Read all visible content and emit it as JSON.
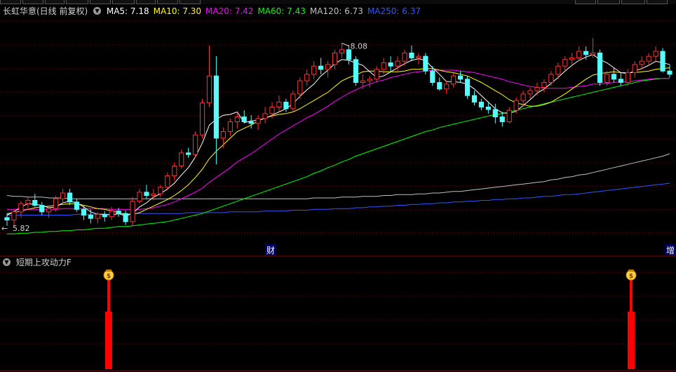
{
  "header": {
    "stock_title": "长虹华意(日线 前复权)",
    "ma_labels": [
      {
        "text": "MA5: 7.18",
        "color": "#ffffff"
      },
      {
        "text": "MA10: 7.30",
        "color": "#ffff00"
      },
      {
        "text": "MA20: 7.42",
        "color": "#ff00ff"
      },
      {
        "text": "MA60: 7.43",
        "color": "#00ff00"
      },
      {
        "text": "MA120: 6.73",
        "color": "#c0c0c0"
      },
      {
        "text": "MA250: 6.37",
        "color": "#3355ff"
      }
    ]
  },
  "sub_panel": {
    "title": "短期上攻动力F"
  },
  "markers": {
    "high_label": "8.08",
    "low_label": "5.82",
    "event_cai": "财",
    "event_zeng": "增",
    "money_glyph": "$"
  },
  "colors": {
    "up": "#ff3232",
    "down": "#54ffff",
    "ma5": "#ffffff",
    "ma10": "#ffff00",
    "ma20": "#ff00ff",
    "ma60": "#00ff00",
    "ma120": "#c0c0c0",
    "ma250": "#3355ff",
    "signal": "#ff0000",
    "grid": "#8b0000"
  },
  "chart_data": [
    {
      "type": "candlestick",
      "title": "长虹华意(日线 前复权)",
      "ylim": [
        5.65,
        8.35
      ],
      "candles": [
        [
          5.95,
          6.0,
          5.85,
          5.92
        ],
        [
          5.92,
          6.05,
          5.84,
          6.02
        ],
        [
          6.02,
          6.15,
          5.95,
          6.12
        ],
        [
          6.12,
          6.2,
          6.05,
          6.16
        ],
        [
          6.16,
          6.24,
          6.08,
          6.1
        ],
        [
          6.1,
          6.14,
          5.98,
          6.02
        ],
        [
          6.02,
          6.1,
          5.95,
          6.06
        ],
        [
          6.06,
          6.22,
          6.02,
          6.18
        ],
        [
          6.18,
          6.3,
          6.12,
          6.25
        ],
        [
          6.25,
          6.3,
          6.1,
          6.14
        ],
        [
          6.14,
          6.18,
          6.02,
          6.05
        ],
        [
          6.05,
          6.1,
          5.92,
          5.98
        ],
        [
          5.98,
          6.05,
          5.88,
          5.94
        ],
        [
          5.94,
          6.02,
          5.88,
          5.99
        ],
        [
          5.99,
          6.03,
          5.9,
          5.96
        ],
        [
          5.96,
          6.08,
          5.92,
          6.03
        ],
        [
          6.03,
          6.07,
          5.96,
          6.0
        ],
        [
          6.0,
          6.04,
          5.86,
          5.9
        ],
        [
          5.9,
          6.2,
          5.85,
          6.15
        ],
        [
          6.15,
          6.3,
          6.12,
          6.26
        ],
        [
          6.26,
          6.35,
          6.18,
          6.22
        ],
        [
          6.22,
          6.3,
          6.16,
          6.24
        ],
        [
          6.24,
          6.35,
          6.2,
          6.32
        ],
        [
          6.32,
          6.5,
          6.28,
          6.46
        ],
        [
          6.46,
          6.62,
          6.4,
          6.58
        ],
        [
          6.58,
          6.78,
          6.55,
          6.74
        ],
        [
          6.74,
          6.8,
          6.68,
          6.72
        ],
        [
          6.72,
          7.0,
          6.68,
          6.96
        ],
        [
          6.96,
          7.4,
          6.92,
          7.35
        ],
        [
          7.35,
          8.05,
          7.3,
          7.68
        ],
        [
          7.68,
          7.92,
          6.6,
          6.92
        ],
        [
          6.92,
          7.05,
          6.8,
          7.0
        ],
        [
          7.0,
          7.16,
          6.95,
          7.12
        ],
        [
          7.12,
          7.24,
          7.04,
          7.18
        ],
        [
          7.18,
          7.26,
          7.1,
          7.12
        ],
        [
          7.12,
          7.2,
          7.04,
          7.1
        ],
        [
          7.1,
          7.2,
          7.02,
          7.16
        ],
        [
          7.16,
          7.3,
          7.1,
          7.22
        ],
        [
          7.22,
          7.36,
          7.16,
          7.3
        ],
        [
          7.3,
          7.44,
          7.24,
          7.36
        ],
        [
          7.36,
          7.4,
          7.24,
          7.28
        ],
        [
          7.28,
          7.5,
          7.24,
          7.46
        ],
        [
          7.46,
          7.66,
          7.4,
          7.62
        ],
        [
          7.62,
          7.76,
          7.56,
          7.7
        ],
        [
          7.7,
          7.86,
          7.64,
          7.8
        ],
        [
          7.8,
          7.9,
          7.7,
          7.76
        ],
        [
          7.76,
          7.86,
          7.66,
          7.82
        ],
        [
          7.82,
          8.0,
          7.76,
          7.96
        ],
        [
          7.96,
          8.08,
          7.9,
          8.0
        ],
        [
          8.0,
          8.06,
          7.82,
          7.88
        ],
        [
          7.88,
          7.92,
          7.56,
          7.6
        ],
        [
          7.6,
          7.7,
          7.52,
          7.62
        ],
        [
          7.62,
          7.68,
          7.54,
          7.64
        ],
        [
          7.64,
          7.8,
          7.6,
          7.76
        ],
        [
          7.76,
          7.9,
          7.7,
          7.84
        ],
        [
          7.84,
          7.92,
          7.74,
          7.8
        ],
        [
          7.8,
          7.92,
          7.72,
          7.86
        ],
        [
          7.86,
          8.0,
          7.8,
          7.96
        ],
        [
          7.96,
          8.05,
          7.86,
          7.9
        ],
        [
          7.9,
          7.96,
          7.82,
          7.92
        ],
        [
          7.92,
          7.96,
          7.7,
          7.74
        ],
        [
          7.74,
          7.8,
          7.56,
          7.6
        ],
        [
          7.6,
          7.66,
          7.5,
          7.52
        ],
        [
          7.52,
          7.62,
          7.46,
          7.58
        ],
        [
          7.58,
          7.72,
          7.54,
          7.68
        ],
        [
          7.68,
          7.74,
          7.6,
          7.64
        ],
        [
          7.64,
          7.68,
          7.4,
          7.44
        ],
        [
          7.44,
          7.5,
          7.32,
          7.36
        ],
        [
          7.36,
          7.4,
          7.26,
          7.3
        ],
        [
          7.3,
          7.36,
          7.22,
          7.27
        ],
        [
          7.27,
          7.34,
          7.1,
          7.18
        ],
        [
          7.18,
          7.24,
          7.06,
          7.12
        ],
        [
          7.12,
          7.3,
          7.1,
          7.26
        ],
        [
          7.26,
          7.42,
          7.22,
          7.38
        ],
        [
          7.38,
          7.5,
          7.3,
          7.46
        ],
        [
          7.46,
          7.54,
          7.4,
          7.5
        ],
        [
          7.5,
          7.6,
          7.44,
          7.54
        ],
        [
          7.54,
          7.64,
          7.48,
          7.6
        ],
        [
          7.6,
          7.74,
          7.56,
          7.7
        ],
        [
          7.7,
          7.84,
          7.64,
          7.8
        ],
        [
          7.8,
          7.92,
          7.74,
          7.88
        ],
        [
          7.88,
          7.96,
          7.8,
          7.9
        ],
        [
          7.9,
          8.04,
          7.86,
          7.98
        ],
        [
          7.98,
          8.04,
          7.88,
          7.94
        ],
        [
          7.94,
          8.14,
          7.9,
          7.96
        ],
        [
          7.96,
          8.0,
          7.56,
          7.6
        ],
        [
          7.6,
          7.74,
          7.56,
          7.7
        ],
        [
          7.7,
          7.78,
          7.6,
          7.64
        ],
        [
          7.64,
          7.72,
          7.56,
          7.6
        ],
        [
          7.6,
          7.76,
          7.56,
          7.72
        ],
        [
          7.72,
          7.86,
          7.66,
          7.82
        ],
        [
          7.82,
          7.92,
          7.76,
          7.86
        ],
        [
          7.86,
          7.96,
          7.8,
          7.92
        ],
        [
          7.92,
          8.04,
          7.84,
          7.98
        ],
        [
          7.98,
          8.02,
          7.72,
          7.74
        ],
        [
          7.74,
          7.82,
          7.66,
          7.7
        ]
      ],
      "ma_lines": {
        "MA5": [
          5.98,
          6.02,
          6.08,
          6.12,
          6.11,
          6.1,
          6.07,
          6.08,
          6.13,
          6.15,
          6.13,
          6.08,
          6.02,
          5.99,
          5.99,
          5.98,
          6.0,
          5.97,
          6.0,
          6.08,
          6.13,
          6.2,
          6.24,
          6.3,
          6.37,
          6.47,
          6.56,
          6.69,
          6.86,
          7.08,
          7.15,
          7.2,
          7.21,
          7.24,
          7.11,
          7.13,
          7.14,
          7.16,
          7.2,
          7.24,
          7.28,
          7.34,
          7.43,
          7.51,
          7.58,
          7.68,
          7.75,
          7.83,
          7.88,
          7.87,
          7.84,
          7.81,
          7.73,
          7.66,
          7.68,
          7.73,
          7.78,
          7.83,
          7.87,
          7.89,
          7.87,
          7.78,
          7.7,
          7.61,
          7.61,
          7.6,
          7.58,
          7.52,
          7.44,
          7.36,
          7.28,
          7.23,
          7.22,
          7.25,
          7.32,
          7.39,
          7.47,
          7.52,
          7.59,
          7.66,
          7.74,
          7.81,
          7.87,
          7.91,
          7.94,
          7.88,
          7.84,
          7.78,
          7.72,
          7.71,
          7.74,
          7.77,
          7.81,
          7.86,
          7.84,
          7.82
        ],
        "MA10": [
          6.0,
          6.01,
          6.03,
          6.05,
          6.07,
          6.08,
          6.09,
          6.1,
          6.11,
          6.12,
          6.12,
          6.1,
          6.08,
          6.06,
          6.05,
          6.03,
          6.01,
          5.99,
          5.99,
          6.01,
          6.05,
          6.09,
          6.13,
          6.17,
          6.22,
          6.28,
          6.35,
          6.44,
          6.54,
          6.67,
          6.76,
          6.84,
          6.92,
          7.0,
          7.04,
          7.08,
          7.13,
          7.17,
          7.19,
          7.21,
          7.22,
          7.24,
          7.28,
          7.33,
          7.38,
          7.43,
          7.48,
          7.55,
          7.62,
          7.66,
          7.69,
          7.73,
          7.74,
          7.74,
          7.73,
          7.73,
          7.73,
          7.74,
          7.76,
          7.76,
          7.77,
          7.77,
          7.75,
          7.73,
          7.72,
          7.7,
          7.68,
          7.64,
          7.6,
          7.55,
          7.5,
          7.45,
          7.39,
          7.35,
          7.33,
          7.31,
          7.31,
          7.33,
          7.36,
          7.41,
          7.46,
          7.52,
          7.58,
          7.64,
          7.69,
          7.71,
          7.72,
          7.73,
          7.72,
          7.72,
          7.72,
          7.73,
          7.74,
          7.76,
          7.77,
          7.78
        ],
        "MA20": [
          6.05,
          6.05,
          6.05,
          6.05,
          6.05,
          6.05,
          6.05,
          6.05,
          6.06,
          6.06,
          6.06,
          6.06,
          6.06,
          6.06,
          6.06,
          6.05,
          6.05,
          6.05,
          6.05,
          6.05,
          6.06,
          6.07,
          6.09,
          6.11,
          6.14,
          6.18,
          6.22,
          6.26,
          6.31,
          6.38,
          6.44,
          6.5,
          6.56,
          6.63,
          6.68,
          6.73,
          6.79,
          6.85,
          6.91,
          6.97,
          7.02,
          7.07,
          7.12,
          7.17,
          7.21,
          7.26,
          7.31,
          7.37,
          7.42,
          7.47,
          7.51,
          7.55,
          7.58,
          7.61,
          7.63,
          7.66,
          7.68,
          7.7,
          7.72,
          7.73,
          7.74,
          7.75,
          7.75,
          7.75,
          7.75,
          7.74,
          7.73,
          7.72,
          7.7,
          7.68,
          7.66,
          7.64,
          7.61,
          7.59,
          7.57,
          7.55,
          7.54,
          7.53,
          7.53,
          7.53,
          7.53,
          7.54,
          7.55,
          7.56,
          7.58,
          7.58,
          7.59,
          7.6,
          7.61,
          7.61,
          7.62,
          7.63,
          7.64,
          7.65,
          7.65,
          7.65
        ],
        "MA60": [
          5.75,
          5.75,
          5.76,
          5.76,
          5.77,
          5.77,
          5.78,
          5.78,
          5.79,
          5.79,
          5.8,
          5.8,
          5.81,
          5.82,
          5.82,
          5.83,
          5.84,
          5.84,
          5.85,
          5.86,
          5.87,
          5.88,
          5.89,
          5.9,
          5.92,
          5.94,
          5.96,
          5.98,
          6.0,
          6.03,
          6.06,
          6.09,
          6.12,
          6.15,
          6.18,
          6.21,
          6.24,
          6.27,
          6.3,
          6.33,
          6.36,
          6.39,
          6.42,
          6.45,
          6.49,
          6.52,
          6.56,
          6.59,
          6.63,
          6.66,
          6.7,
          6.73,
          6.76,
          6.79,
          6.82,
          6.85,
          6.88,
          6.91,
          6.94,
          6.97,
          7.0,
          7.02,
          7.05,
          7.07,
          7.09,
          7.11,
          7.13,
          7.15,
          7.17,
          7.19,
          7.21,
          7.22,
          7.24,
          7.26,
          7.28,
          7.3,
          7.32,
          7.34,
          7.36,
          7.38,
          7.4,
          7.42,
          7.44,
          7.46,
          7.48,
          7.5,
          7.52,
          7.54,
          7.56,
          7.58,
          7.6,
          7.62,
          7.63,
          7.64,
          7.65,
          7.65
        ],
        "MA120": [
          6.22,
          6.21,
          6.21,
          6.2,
          6.2,
          6.2,
          6.19,
          6.19,
          6.19,
          6.18,
          6.18,
          6.18,
          6.18,
          6.18,
          6.18,
          6.18,
          6.18,
          6.18,
          6.18,
          6.18,
          6.18,
          6.18,
          6.18,
          6.18,
          6.18,
          6.18,
          6.18,
          6.18,
          6.18,
          6.18,
          6.18,
          6.18,
          6.18,
          6.18,
          6.18,
          6.18,
          6.18,
          6.18,
          6.18,
          6.18,
          6.18,
          6.18,
          6.18,
          6.18,
          6.19,
          6.19,
          6.19,
          6.19,
          6.2,
          6.2,
          6.2,
          6.21,
          6.21,
          6.21,
          6.22,
          6.22,
          6.23,
          6.23,
          6.23,
          6.24,
          6.24,
          6.25,
          6.25,
          6.26,
          6.27,
          6.27,
          6.28,
          6.29,
          6.3,
          6.31,
          6.32,
          6.33,
          6.34,
          6.35,
          6.36,
          6.37,
          6.38,
          6.39,
          6.41,
          6.42,
          6.44,
          6.45,
          6.47,
          6.48,
          6.5,
          6.52,
          6.54,
          6.56,
          6.58,
          6.6,
          6.62,
          6.64,
          6.66,
          6.68,
          6.7,
          6.73
        ],
        "MA250": [
          5.98,
          5.98,
          5.98,
          5.98,
          5.98,
          5.98,
          5.98,
          5.98,
          5.98,
          5.98,
          5.99,
          5.99,
          5.99,
          5.99,
          5.99,
          5.99,
          5.99,
          5.99,
          6.0,
          6.0,
          6.0,
          6.0,
          6.0,
          6.0,
          6.0,
          6.0,
          6.01,
          6.01,
          6.01,
          6.01,
          6.01,
          6.01,
          6.02,
          6.02,
          6.02,
          6.02,
          6.02,
          6.03,
          6.03,
          6.03,
          6.03,
          6.04,
          6.04,
          6.04,
          6.05,
          6.05,
          6.05,
          6.06,
          6.06,
          6.06,
          6.07,
          6.07,
          6.08,
          6.08,
          6.09,
          6.09,
          6.1,
          6.1,
          6.11,
          6.11,
          6.12,
          6.12,
          6.13,
          6.13,
          6.14,
          6.14,
          6.15,
          6.15,
          6.16,
          6.16,
          6.17,
          6.17,
          6.18,
          6.18,
          6.19,
          6.19,
          6.2,
          6.21,
          6.21,
          6.22,
          6.23,
          6.23,
          6.24,
          6.25,
          6.26,
          6.27,
          6.28,
          6.29,
          6.3,
          6.31,
          6.32,
          6.33,
          6.34,
          6.35,
          6.36,
          6.37
        ]
      },
      "annotations": [
        {
          "text": "8.08",
          "candle_index": 48,
          "value": 8.08
        },
        {
          "text": "5.82",
          "candle_index": 0,
          "value": 5.82
        }
      ]
    },
    {
      "type": "bar",
      "title": "短期上攻动力F",
      "signal_candle_indices": [
        16,
        94
      ],
      "values": [
        1,
        1
      ]
    }
  ]
}
